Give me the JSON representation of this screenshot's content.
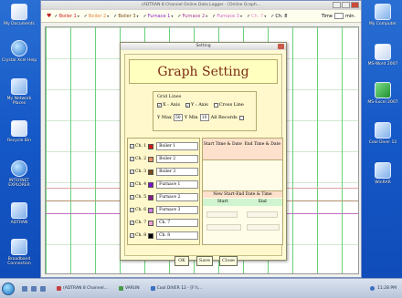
{
  "app": {
    "title": "(ADTRAN 8 Channel Online Data Logger - [Online Graph...",
    "legend": [
      {
        "label": "Boiler 1",
        "color": "#cc2020"
      },
      {
        "label": "Boiler 2",
        "color": "#e08040"
      },
      {
        "label": "Boiler 3",
        "color": "#7a4a18"
      },
      {
        "label": "Furnace 1",
        "color": "#8b20c0"
      },
      {
        "label": "Furnace 2",
        "color": "#a030a0"
      },
      {
        "label": "Furnace 3",
        "color": "#d060d0"
      },
      {
        "label": "Ch. 7",
        "color": "#e888c8"
      },
      {
        "label": "Ch. 8",
        "color": "#222222"
      }
    ],
    "time_label": "Time",
    "time_unit": "min."
  },
  "dialog": {
    "title": "Setting",
    "heading": "Graph Setting",
    "grid_lines": {
      "title": "Grid Lines",
      "x_axis": "X : Axis",
      "y_axis": "Y : Axis",
      "cross_line": "Cross Line",
      "x_checked": true,
      "y_checked": true,
      "cross_checked": false
    },
    "y_max_label": "Y Max",
    "y_max_value": "50",
    "y_min_label": "Y Min",
    "y_min_value": "10",
    "all_records_label": "All Records",
    "channels": [
      {
        "ch": "Ch. 1",
        "color": "#d01818",
        "name": "Boiler 1"
      },
      {
        "ch": "Ch. 2",
        "color": "#e89060",
        "name": "Boiler 2"
      },
      {
        "ch": "Ch. 3",
        "color": "#7a4a18",
        "name": "Boiler 3"
      },
      {
        "ch": "Ch. 4",
        "color": "#7a10c8",
        "name": "Furnace 1"
      },
      {
        "ch": "Ch. 5",
        "color": "#8a1a8a",
        "name": "Furnace 2"
      },
      {
        "ch": "Ch. 6",
        "color": "#d080e0",
        "name": "Furnace 3"
      },
      {
        "ch": "Ch. 7",
        "color": "#f0a0d0",
        "name": "Ch. 7"
      },
      {
        "ch": "Ch. 8",
        "color": "#000000",
        "name": "Ch. 8"
      }
    ],
    "start_time_header": "Start Time & Date",
    "end_time_header": "End Time & Date",
    "new_range_header": "New Start-End  Date & Time",
    "start_label": "Start",
    "end_label": "End",
    "ok_label": "OK",
    "save_label": "Save",
    "close_label": "Close"
  },
  "desktop": {
    "left_icons": [
      "My Documents",
      "Crystal Xcel Help",
      "My Network Places",
      "Recycle Bin",
      "INTERNET EXPLORER",
      "ADTRAN",
      "Broadband Connection"
    ],
    "right_icons": [
      "My Computer",
      "MS-Word 2007",
      "MS-Excel 2007",
      "Cool Diver 12",
      "WinRAR"
    ]
  },
  "taskbar": {
    "tasks": [
      "(ADTRAN 8 Channel...",
      "VARUN",
      "Cool DIVER 12 - [F:\\\\..."
    ],
    "clock": "11:28 PM"
  }
}
